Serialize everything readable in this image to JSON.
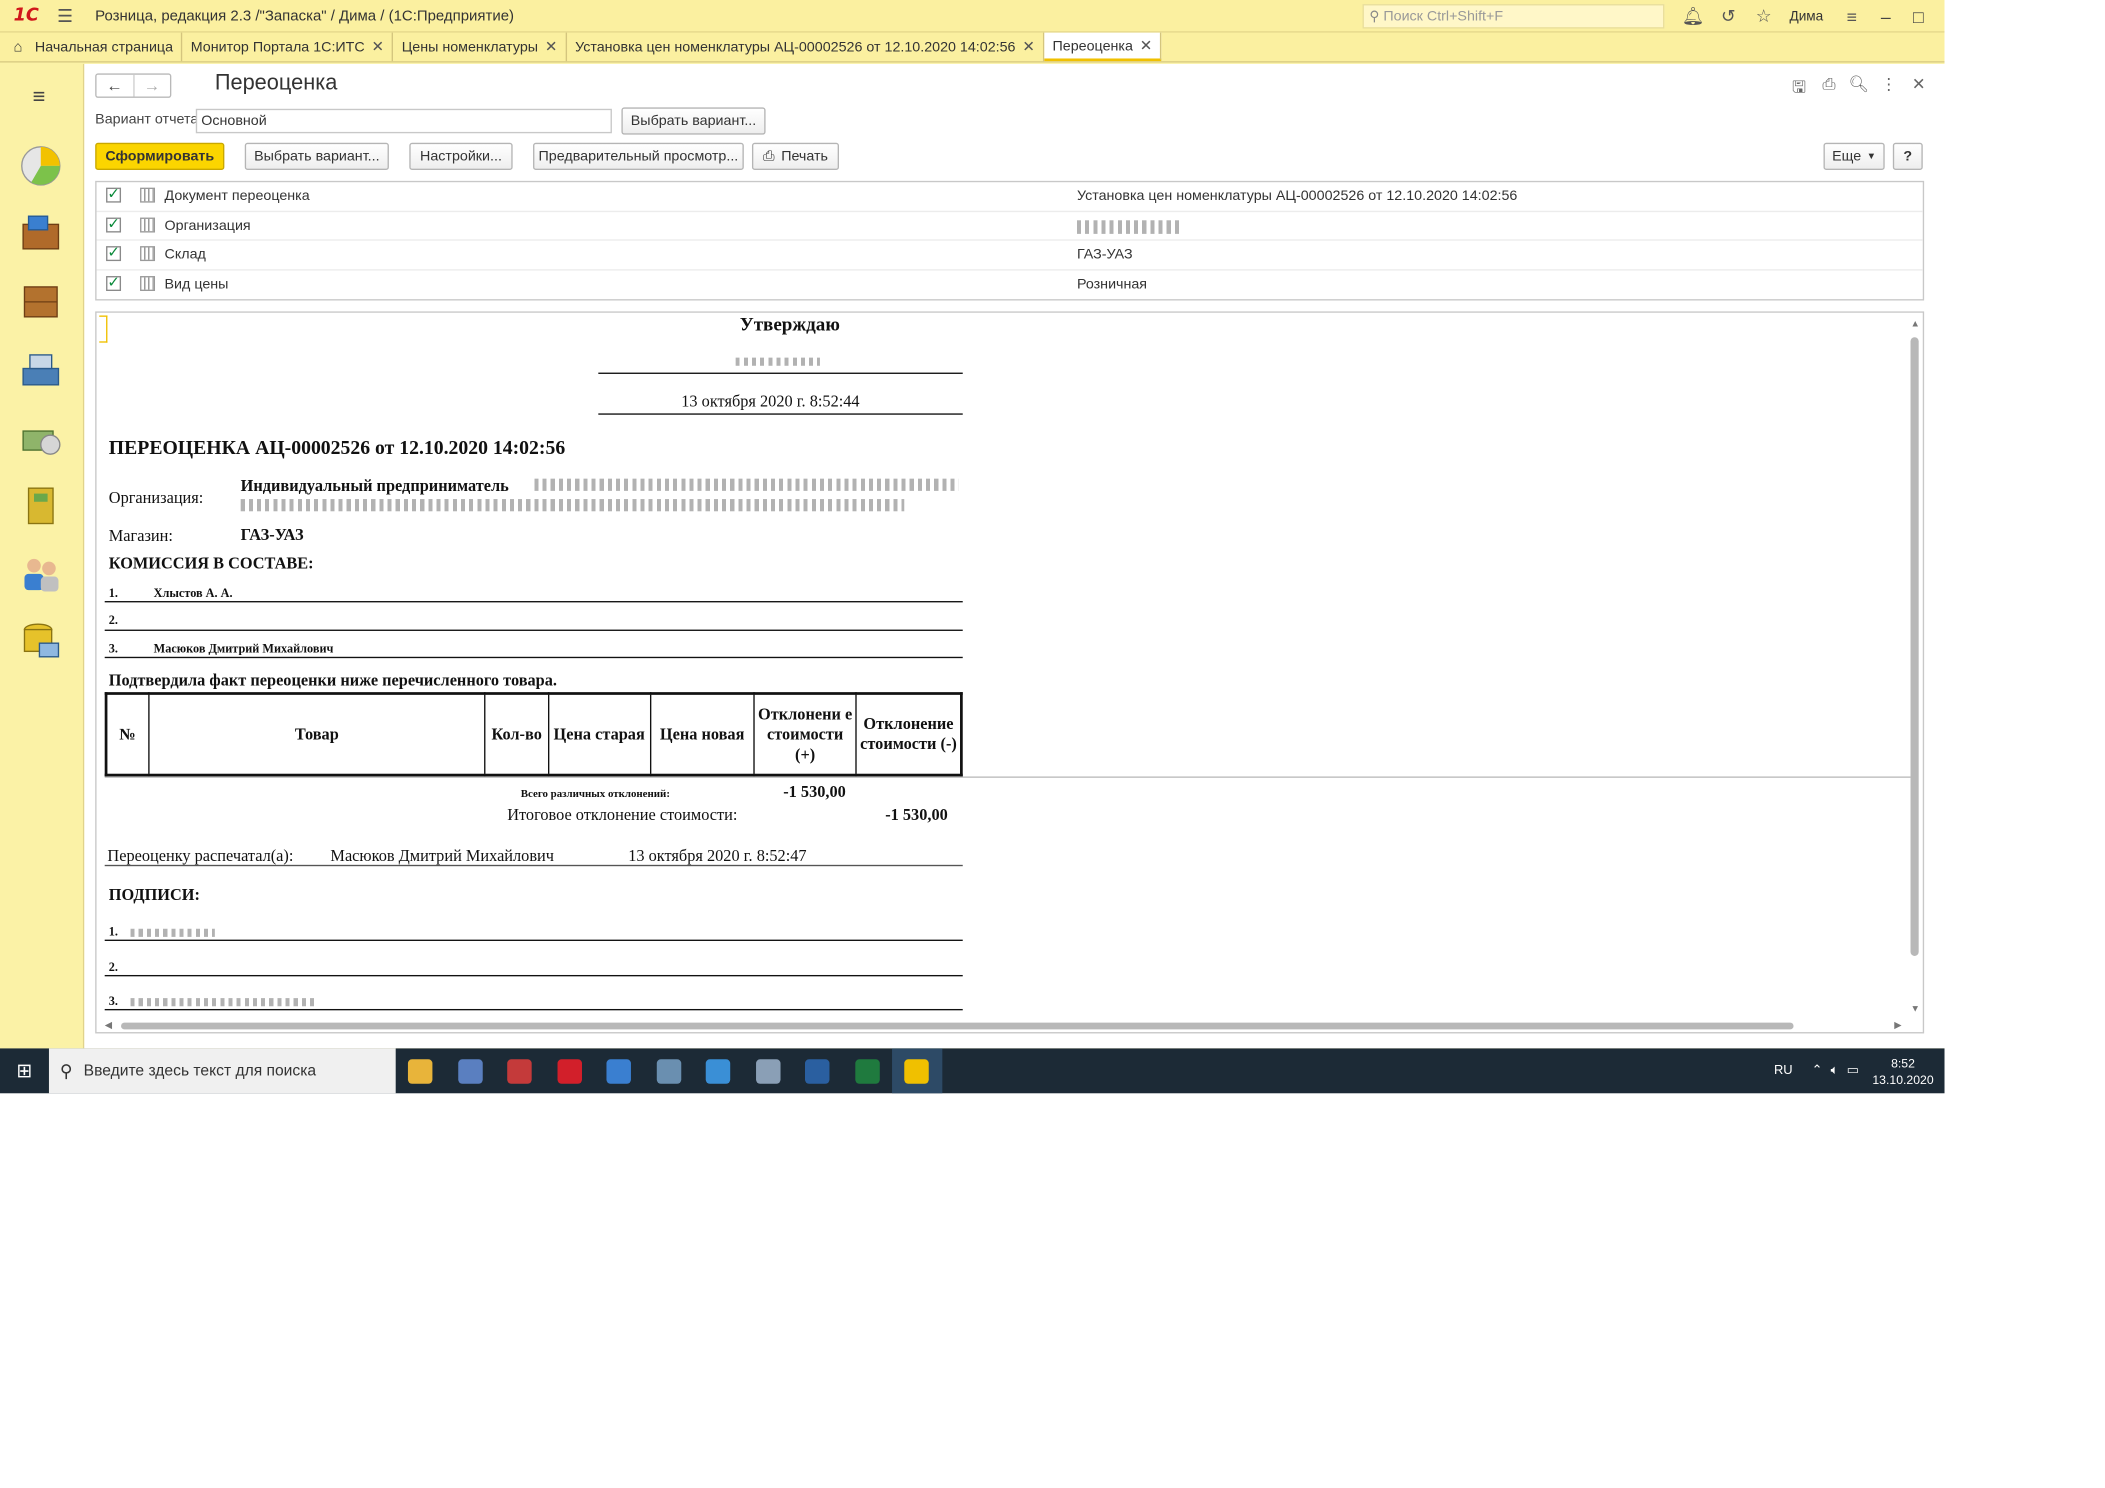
{
  "titlebar": {
    "logo": "1С",
    "title": "Розница, редакция 2.3 /\"Запаска\" / Дима /  (1С:Предприятие)",
    "search_placeholder": "Поиск Ctrl+Shift+F",
    "user": "Дима"
  },
  "tabs": [
    {
      "label": "Начальная страница"
    },
    {
      "label": "Монитор Портала 1С:ИТС"
    },
    {
      "label": "Цены номенклатуры"
    },
    {
      "label": "Установка цен номенклатуры АЦ-00002526 от 12.10.2020 14:02:56"
    },
    {
      "label": "Переоценка"
    }
  ],
  "form": {
    "title": "Переоценка",
    "variant_label": "Вариант отчета:",
    "variant_value": "Основной",
    "choose_variant_btn": "Выбрать вариант...",
    "generate_btn": "Сформировать",
    "choose_variant_btn2": "Выбрать вариант...",
    "settings_btn": "Настройки...",
    "preview_btn": "Предварительный просмотр...",
    "print_btn": "Печать",
    "more_btn": "Еще",
    "help_btn": "?"
  },
  "settings": [
    {
      "name": "Документ переоценка",
      "value": "Установка цен номенклатуры АЦ-00002526 от 12.10.2020 14:02:56"
    },
    {
      "name": "Организация",
      "value": ""
    },
    {
      "name": "Склад",
      "value": "ГАЗ-УАЗ"
    },
    {
      "name": "Вид цены",
      "value": "Розничная"
    }
  ],
  "report": {
    "approve": "Утверждаю",
    "approve_date": "13 октября 2020 г. 8:52:44",
    "doc_title": "ПЕРЕОЦЕНКА АЦ-00002526 от 12.10.2020 14:02:56",
    "org_label": "Организация:",
    "org_value": "Индивидуальный предприниматель",
    "shop_label": "Магазин:",
    "shop_value": "ГАЗ-УАЗ",
    "commission_title": "КОМИССИЯ В СОСТАВЕ:",
    "commission": [
      {
        "n": "1.",
        "name": "Хлыстов А. А."
      },
      {
        "n": "2.",
        "name": ""
      },
      {
        "n": "3.",
        "name": "Масюков Дмитрий Михайлович"
      }
    ],
    "confirm_text": "Подтвердила факт переоценки ниже перечисленного товара.",
    "table_headers": [
      "№",
      "Товар",
      "Кол-во",
      "Цена старая",
      "Цена новая",
      "Отклонени е стоимости (+)",
      "Отклонение стоимости (-)"
    ],
    "total_diff_label": "Всего различных отклонений:",
    "total_diff_value": "-1 530,00",
    "final_diff_label": "Итоговое отклонение стоимости:",
    "final_diff_value": "-1 530,00",
    "printed_label": "Переоценку распечатал(а):",
    "printed_by": "Масюков Дмитрий Михайлович",
    "printed_date": "13 октября 2020 г. 8:52:47",
    "signatures_title": "ПОДПИСИ:",
    "signatures": [
      "1.",
      "2.",
      "3."
    ]
  },
  "taskbar": {
    "search_placeholder": "Введите здесь текст для поиска",
    "lang": "RU",
    "time": "8:52",
    "date": "13.10.2020",
    "apps": [
      {
        "icon": "file-explorer-icon",
        "color": "#e8b43a"
      },
      {
        "icon": "app-icon",
        "color": "#5a7fc0"
      },
      {
        "icon": "mail-icon",
        "color": "#c43a3a"
      },
      {
        "icon": "opera-icon",
        "color": "#d21f2a"
      },
      {
        "icon": "browser-icon",
        "color": "#3a7fd0"
      },
      {
        "icon": "network-icon",
        "color": "#6a8fb0"
      },
      {
        "icon": "k-app-icon",
        "color": "#3a8fd6"
      },
      {
        "icon": "messenger-icon",
        "color": "#8a9fb6"
      },
      {
        "icon": "b-app-icon",
        "color": "#2a5fa0"
      },
      {
        "icon": "excel-icon",
        "color": "#1f7a3e"
      },
      {
        "icon": "1c-icon",
        "color": "#f0c000"
      }
    ]
  }
}
